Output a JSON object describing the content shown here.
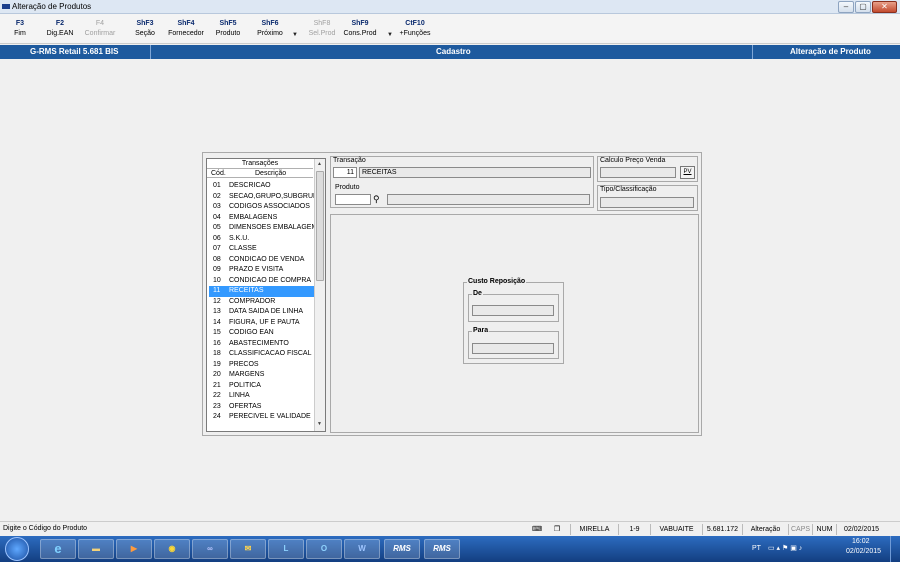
{
  "window": {
    "title": "Alteração de Produtos"
  },
  "toolbar": {
    "buttons": [
      {
        "key": "F3",
        "label": "Fim",
        "enabled": true
      },
      {
        "key": "F2",
        "label": "Dig.EAN",
        "enabled": true
      },
      {
        "key": "F4",
        "label": "Confirmar",
        "enabled": false
      },
      {
        "key": "ShF3",
        "label": "Seção",
        "enabled": true
      },
      {
        "key": "ShF4",
        "label": "Fornecedor",
        "enabled": true
      },
      {
        "key": "ShF5",
        "label": "Produto",
        "enabled": true
      },
      {
        "key": "ShF6",
        "label": "Próximo",
        "enabled": true
      },
      {
        "key": "ShF8",
        "label": "Sel.Prod",
        "enabled": false
      },
      {
        "key": "ShF9",
        "label": "Cons.Prod",
        "enabled": true
      },
      {
        "key": "CtF10",
        "label": "+Funções",
        "enabled": true
      }
    ]
  },
  "header": {
    "system": "G-RMS Retail 5.681 BIS",
    "module": "Cadastro",
    "function": "Alteração de Produto"
  },
  "transacoes": {
    "title": "Transações",
    "col_cod": "Cód.",
    "col_desc": "Descrição",
    "selected_code": "11",
    "items": [
      {
        "cod": "01",
        "desc": "DESCRICAO"
      },
      {
        "cod": "02",
        "desc": "SECAO,GRUPO,SUBGRUPO"
      },
      {
        "cod": "03",
        "desc": "CODIGOS ASSOCIADOS"
      },
      {
        "cod": "04",
        "desc": "EMBALAGENS"
      },
      {
        "cod": "05",
        "desc": "DIMENSOES EMBALAGEM"
      },
      {
        "cod": "06",
        "desc": "S.K.U."
      },
      {
        "cod": "07",
        "desc": "CLASSE"
      },
      {
        "cod": "08",
        "desc": "CONDICAO DE VENDA"
      },
      {
        "cod": "09",
        "desc": "PRAZO E VISITA"
      },
      {
        "cod": "10",
        "desc": "CONDICAO DE COMPRA"
      },
      {
        "cod": "11",
        "desc": "RECEITAS"
      },
      {
        "cod": "12",
        "desc": "COMPRADOR"
      },
      {
        "cod": "13",
        "desc": "DATA SAIDA DE LINHA"
      },
      {
        "cod": "14",
        "desc": "FIGURA, UF E PAUTA"
      },
      {
        "cod": "15",
        "desc": "CODIGO EAN"
      },
      {
        "cod": "16",
        "desc": "ABASTECIMENTO"
      },
      {
        "cod": "18",
        "desc": "CLASSIFICACAO FISCAL"
      },
      {
        "cod": "19",
        "desc": "PRECOS"
      },
      {
        "cod": "20",
        "desc": "MARGENS"
      },
      {
        "cod": "21",
        "desc": "POLITICA"
      },
      {
        "cod": "22",
        "desc": "LINHA"
      },
      {
        "cod": "23",
        "desc": "OFERTAS"
      },
      {
        "cod": "24",
        "desc": "PERECIVEL E VALIDADE"
      }
    ]
  },
  "transacao": {
    "label": "Transação",
    "code": "11",
    "name": "RECEITAS"
  },
  "produto": {
    "label": "Produto",
    "code": "",
    "desc": ""
  },
  "calculo": {
    "label": "Calculo Preço Venda",
    "value": "",
    "button": "PV"
  },
  "tipo": {
    "label": "Tipo/Classificação",
    "value": ""
  },
  "custo": {
    "label": "Custo Reposição",
    "de_label": "De",
    "de_value": "",
    "para_label": "Para",
    "para_value": ""
  },
  "status": {
    "hint": "Digite o Código do Produto",
    "user": "MIRELLA",
    "range": "1-9",
    "host": "VABUAITE",
    "version": "5.681.172",
    "mode": "Alteração",
    "caps": "CAPS",
    "num": "NUM",
    "date": "02/02/2015"
  },
  "taskbar": {
    "lang": "PT",
    "time": "16:02",
    "date": "02/02/2015",
    "apps": [
      "RMS",
      "RMS"
    ]
  }
}
